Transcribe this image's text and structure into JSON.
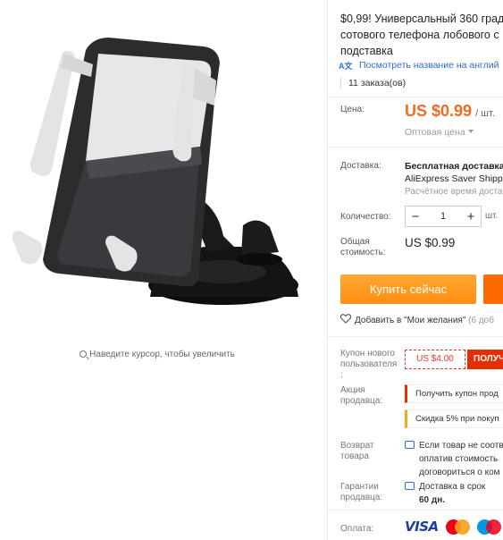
{
  "gallery": {
    "zoom_hint": "Наведите курсор, чтобы увеличить"
  },
  "product": {
    "title_lines": [
      "$0,99! Универсальный 360 град",
      "сотового телефона лобового с",
      "подставка"
    ],
    "translate_link": "Посмотреть название на англий",
    "orders": "11 заказа(ов)"
  },
  "price": {
    "label": "Цена:",
    "value": "US $0.99",
    "unit": "/ шт.",
    "wholesale": "Оптовая цена"
  },
  "shipping": {
    "label": "Доставка:",
    "title_lines": [
      "Бесплатная доставка",
      "AliExpress Saver Shipp"
    ],
    "estimate": "Расчётное время доста"
  },
  "quantity": {
    "label": "Количество:",
    "minus": "−",
    "value": "1",
    "plus": "+",
    "unit": "шт."
  },
  "total": {
    "label_lines": [
      "Общая",
      "стоимость:"
    ],
    "value": "US $0.99"
  },
  "actions": {
    "buy_now": "Купить сейчас",
    "wishlist": "Добавить в \"Мои желания\"",
    "wishlist_count": "(6 доб"
  },
  "coupon": {
    "label_lines": [
      "Купон нового",
      "пользователя",
      ":"
    ],
    "amount": "US $4.00",
    "get": "ПОЛУЧ"
  },
  "promotion": {
    "label_lines": [
      "Акция",
      "продавца:"
    ],
    "get_coupon": "Получить купон прод",
    "discount": "Скидка 5% при покуп"
  },
  "return_policy": {
    "label_lines": [
      "Возврат",
      "товара"
    ],
    "text_lines": [
      "Если товар не соотв",
      "оплатив стоимость",
      "договориться о ком"
    ]
  },
  "guarantee": {
    "label_lines": [
      "Гарантии",
      "продавца:"
    ],
    "line1": "Доставка в срок",
    "line2": "60 дн."
  },
  "payment": {
    "label": "Оплата:",
    "visa": "VISA",
    "logos": [
      "visa-logo",
      "mastercard-logo",
      "maestro-logo"
    ]
  },
  "colors": {
    "accent_orange": "#f26a23",
    "buy_button": "#ff9a1f",
    "coupon_red": "#e62e04",
    "link_blue": "#2a6ed3"
  }
}
